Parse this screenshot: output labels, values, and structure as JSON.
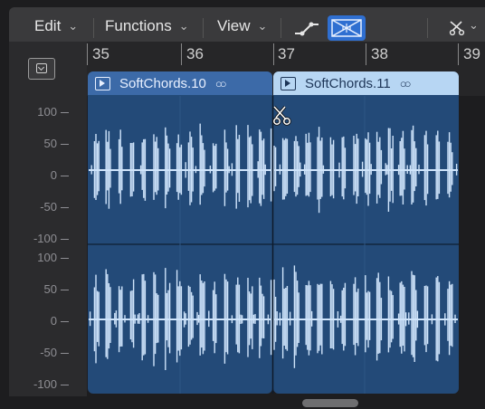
{
  "menubar": {
    "edit": "Edit",
    "functions": "Functions",
    "view": "View",
    "chevron": "⌄"
  },
  "ruler": {
    "bars": [
      "35",
      "36",
      "37",
      "38",
      "39"
    ]
  },
  "regions": [
    {
      "name": "SoftChords.10",
      "selected": true,
      "color": "#3c6aa8"
    },
    {
      "name": "SoftChords.11",
      "selected": false,
      "color": "#b7d6f3"
    }
  ],
  "amplitude_labels": {
    "top_channel": [
      "100",
      "50",
      "0",
      "-50",
      "-100"
    ],
    "bottom_channel": [
      "100",
      "50",
      "0",
      "-50",
      "-100"
    ]
  },
  "colors": {
    "waveform": "#cfe4fb",
    "region_body": "#234a78",
    "accent": "#2f6fd1"
  },
  "icons": {
    "disclosure": "collapse-icon",
    "cursor": "scissors-icon",
    "stereo": "stereo-rings-icon"
  }
}
